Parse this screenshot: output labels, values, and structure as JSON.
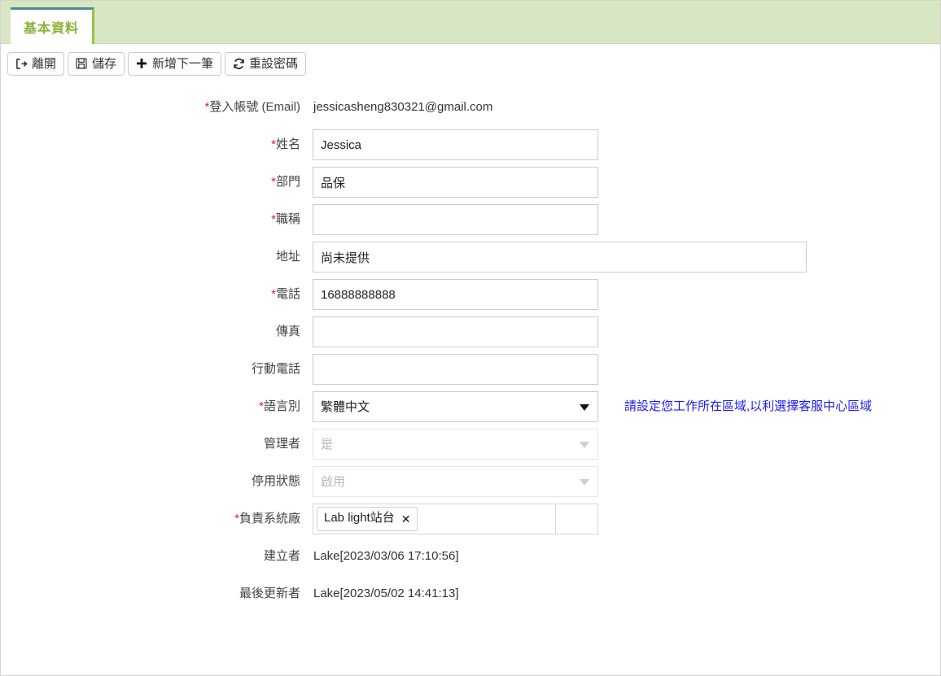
{
  "tab": {
    "label": "基本資料"
  },
  "toolbar": {
    "buttons": [
      {
        "label": "離開",
        "icon": "sign-out-icon"
      },
      {
        "label": "儲存",
        "icon": "floppy-save-icon"
      },
      {
        "label": "新增下一筆",
        "icon": "plus-icon"
      },
      {
        "label": "重設密碼",
        "icon": "refresh-sync-icon"
      }
    ]
  },
  "form": {
    "email": {
      "label": "登入帳號 (Email)",
      "required": true,
      "value": "jessicasheng830321@gmail.com"
    },
    "name": {
      "label": "姓名",
      "required": true,
      "value": "Jessica",
      "placeholder": ""
    },
    "department": {
      "label": "部門",
      "required": true,
      "value": "品保",
      "placeholder": ""
    },
    "title": {
      "label": "職稱",
      "required": true,
      "value": "",
      "placeholder": ""
    },
    "address": {
      "label": "地址",
      "required": false,
      "value": "尚未提供",
      "placeholder": ""
    },
    "phone": {
      "label": "電話",
      "required": true,
      "value": "16888888888",
      "placeholder": ""
    },
    "fax": {
      "label": "傳真",
      "required": false,
      "value": "",
      "placeholder": ""
    },
    "mobile": {
      "label": "行動電話",
      "required": false,
      "value": "",
      "placeholder": ""
    },
    "language": {
      "label": "語言別",
      "required": true,
      "value": "繁體中文",
      "options": [
        "繁體中文"
      ],
      "hint": "請設定您工作所在區域,以利選擇客服中心區域"
    },
    "manager": {
      "label": "管理者",
      "required": false,
      "value": "是",
      "options": [
        "是"
      ],
      "disabled": true
    },
    "status": {
      "label": "停用狀態",
      "required": false,
      "value": "啟用",
      "options": [
        "啟用"
      ],
      "disabled": true
    },
    "system_plant": {
      "label": "負責系統廠",
      "required": true,
      "tags": [
        {
          "label": "Lab light站台",
          "remove": "✕"
        }
      ]
    },
    "created_by": {
      "label": "建立者",
      "required": false,
      "value": "Lake[2023/03/06 17:10:56]"
    },
    "updated_by": {
      "label": "最後更新者",
      "required": false,
      "value": "Lake[2023/05/02 14:41:13]"
    }
  },
  "colors": {
    "tab_header_bg": "#d7e7c4",
    "tab_text": "#8cb33a",
    "tab_top_border": "#4b8ba0",
    "tab_right_border": "#9cc04a",
    "required_asterisk": "#e02020",
    "hint_text": "#1a1af0"
  }
}
